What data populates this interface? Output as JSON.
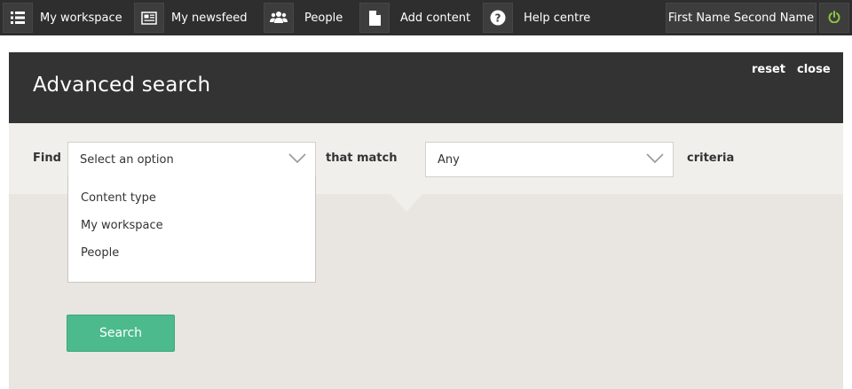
{
  "topbar": {
    "items": [
      {
        "label": "My workspace",
        "icon": "list-icon"
      },
      {
        "label": "My newsfeed",
        "icon": "newspaper-icon"
      },
      {
        "label": "People",
        "icon": "people-icon"
      },
      {
        "label": "Add content",
        "icon": "document-icon"
      },
      {
        "label": "Help centre",
        "icon": "question-icon"
      }
    ],
    "user_name": "First Name Second Name",
    "power_icon": "power-icon",
    "power_color": "#8dc63f"
  },
  "panel": {
    "title": "Advanced search",
    "reset_label": "reset",
    "close_label": "close"
  },
  "search": {
    "find_label": "Find",
    "find_select_value": "Select an option",
    "that_match_label": "that match",
    "match_select_value": "Any",
    "criteria_label": "criteria",
    "options": [
      "Content type",
      "My workspace",
      "People"
    ],
    "button_label": "Search",
    "button_color": "#4cba8d"
  }
}
